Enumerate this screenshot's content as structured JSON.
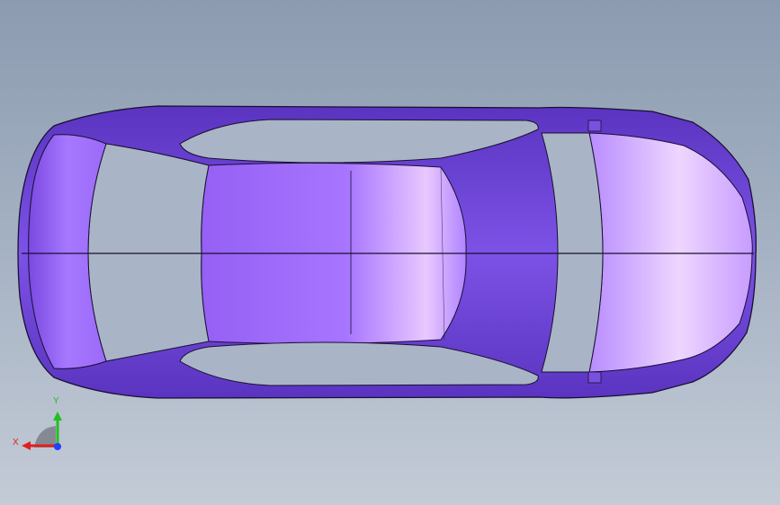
{
  "viewport": {
    "view": "top",
    "background_top": "#8c9bb0",
    "background_bottom": "#c3cbd6"
  },
  "model": {
    "icon": "car-body-icon",
    "body_color": "#8a5cf0",
    "highlight_color": "#f3dcff",
    "edge_color": "#1a0f33"
  },
  "triad": {
    "x_label": "X",
    "y_label": "Y",
    "x_color": "#e02020",
    "y_color": "#20c020",
    "z_color": "#2040ff"
  }
}
